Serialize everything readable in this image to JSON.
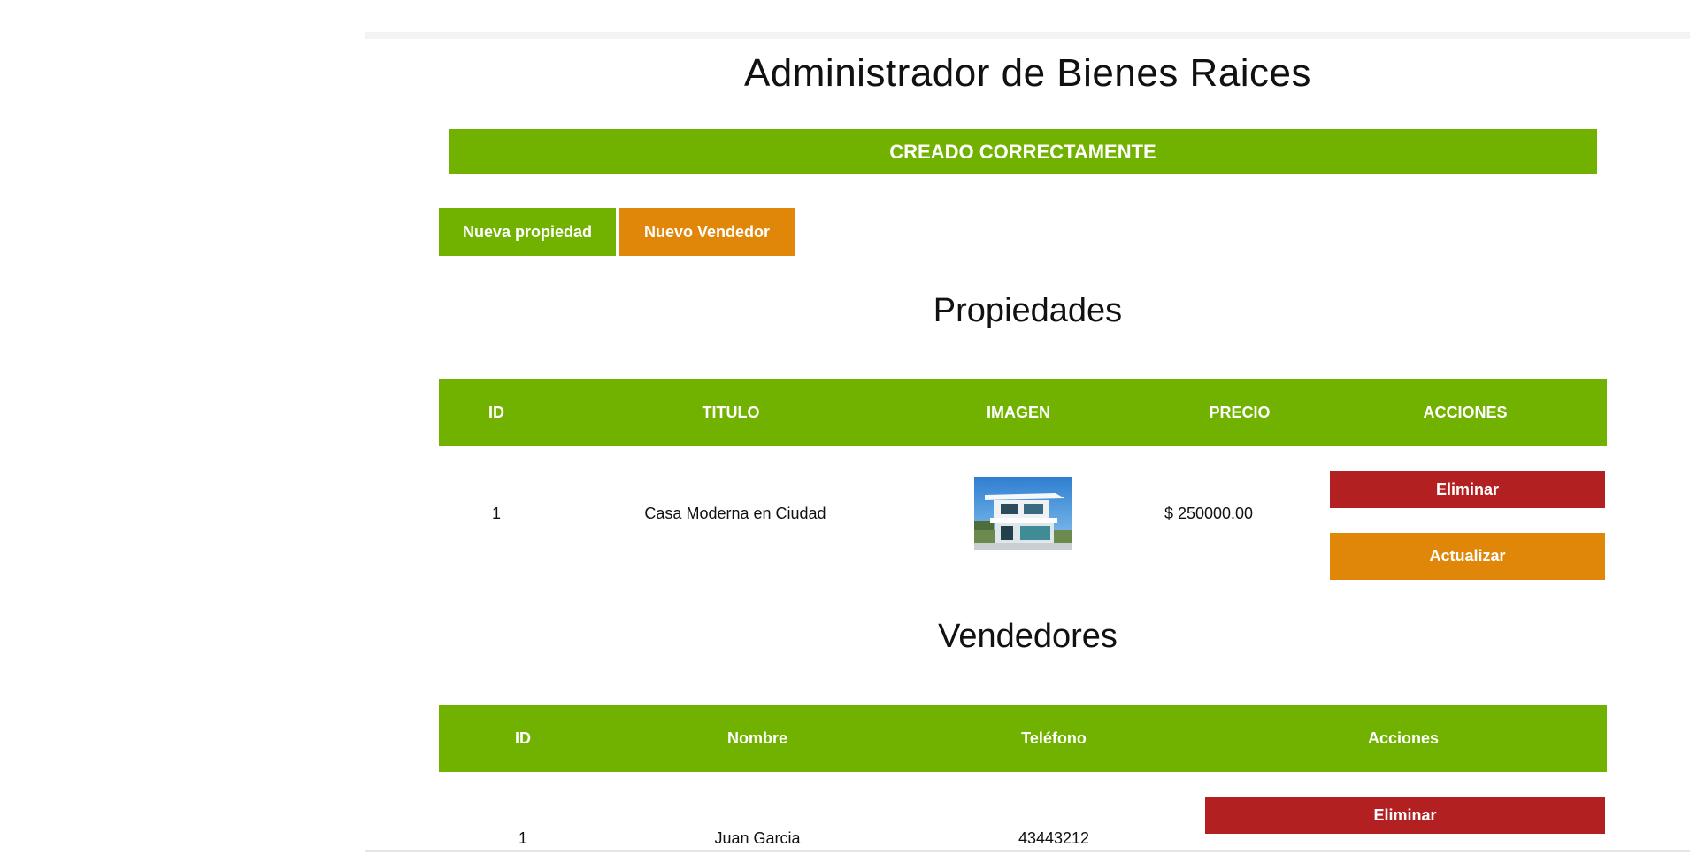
{
  "page": {
    "title": "Administrador de Bienes Raices"
  },
  "alert": {
    "message": "CREADO CORRECTAMENTE"
  },
  "actions": {
    "new_property": "Nueva propiedad",
    "new_seller": "Nuevo Vendedor"
  },
  "propiedades": {
    "heading": "Propiedades",
    "columns": [
      "ID",
      "TITULO",
      "IMAGEN",
      "PRECIO",
      "ACCIONES"
    ],
    "rows": [
      {
        "id": "1",
        "titulo": "Casa Moderna en Ciudad",
        "imagen": "modern-house-photo",
        "precio": "$ 250000.00",
        "delete_label": "Eliminar",
        "update_label": "Actualizar"
      }
    ]
  },
  "vendedores": {
    "heading": "Vendedores",
    "columns": [
      "ID",
      "Nombre",
      "Teléfono",
      "Acciones"
    ],
    "rows": [
      {
        "id": "1",
        "nombre": "Juan Garcia",
        "telefono": "43443212",
        "delete_label": "Eliminar"
      }
    ]
  },
  "colors": {
    "green": "#71b100",
    "orange": "#e08709",
    "red": "#b32021"
  }
}
